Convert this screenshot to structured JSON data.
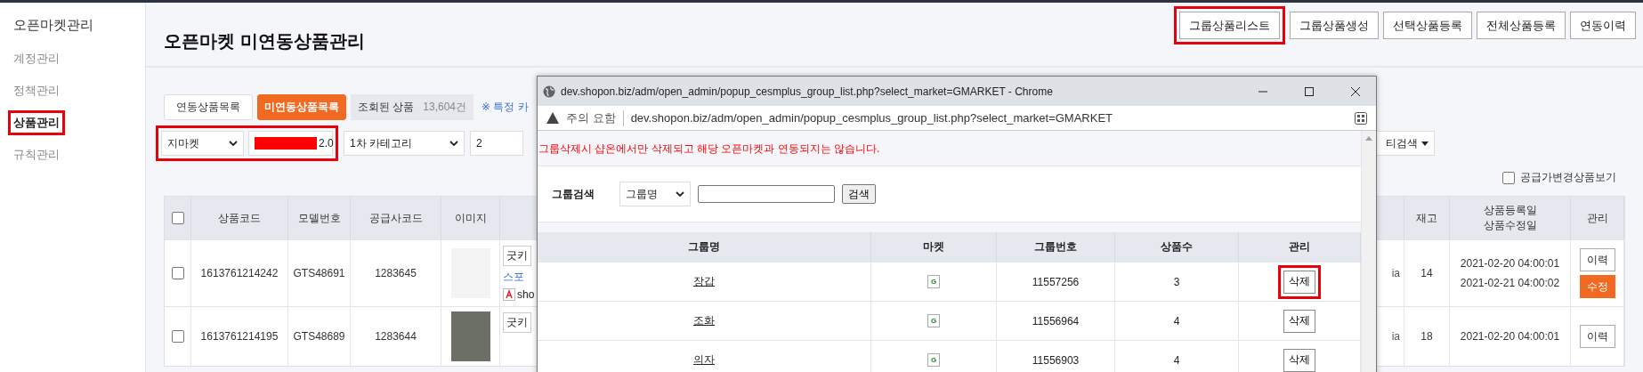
{
  "sidebar": {
    "title": "오픈마켓관리",
    "items": [
      {
        "label": "계정관리",
        "selected": false,
        "highlighted": false
      },
      {
        "label": "정책관리",
        "selected": false,
        "highlighted": false
      },
      {
        "label": "상품관리",
        "selected": true,
        "highlighted": true
      },
      {
        "label": "규칙관리",
        "selected": false,
        "highlighted": false
      }
    ]
  },
  "header": {
    "title": "오픈마켓 미연동상품관리",
    "buttons": [
      {
        "label": "그룹상품리스트",
        "highlighted": true
      },
      {
        "label": "그룹상품생성",
        "highlighted": false
      },
      {
        "label": "선택상품등록",
        "highlighted": false
      },
      {
        "label": "전체상품등록",
        "highlighted": false
      },
      {
        "label": "연동이력",
        "highlighted": false
      }
    ]
  },
  "tabs": [
    {
      "label": "연동상품목록",
      "selected": false
    },
    {
      "label": "미연동상품목록",
      "selected": true
    }
  ],
  "result": {
    "label": "조회된 상품",
    "count": "13,604건"
  },
  "notice": "※ 특정 카",
  "market_filters": {
    "highlighted": true,
    "selects": [
      {
        "value": "지마켓",
        "redacted": false
      },
      {
        "value": "2.0",
        "redacted": true
      }
    ]
  },
  "category_filters": [
    "1차 카테고리",
    "2"
  ],
  "search_toggle": "티검색",
  "supply_price_toggle": {
    "label": "공급가변경상품보기",
    "checked": false
  },
  "table": {
    "select_all": {
      "checked": false
    },
    "columns": [
      {
        "label": "상품코드"
      },
      {
        "label": "모델번호"
      },
      {
        "label": "공급사코드"
      },
      {
        "label": "이미지"
      },
      {
        "label": "재고"
      },
      {
        "label": "상품등록일",
        "sublabel": "상품수정일"
      },
      {
        "label": "관리"
      }
    ],
    "rows": [
      {
        "checked": false,
        "product_code": "1613761214242",
        "model_no": "GTS48691",
        "supplier_code": "1283645",
        "name_lines": [
          "굿키",
          "스포"
        ],
        "shop": "sho",
        "trailing": "ia",
        "stock": "14",
        "registered": "2021-02-20 04:00:01",
        "modified": "2021-02-21 04:00:02",
        "actions": [
          {
            "kind": "history",
            "label": "이력"
          },
          {
            "kind": "edit",
            "label": "수정"
          }
        ]
      },
      {
        "checked": false,
        "product_code": "1613761214195",
        "model_no": "GTS48689",
        "supplier_code": "1283644",
        "name_lines": [
          "굿키"
        ],
        "trailing": "ia",
        "stock": "18",
        "registered": "2021-02-20 04:00:01",
        "actions": [
          {
            "kind": "history",
            "label": "이력"
          }
        ]
      }
    ]
  },
  "popup": {
    "title": "dev.shopon.biz/adm/open_admin/popup_cesmplus_group_list.php?select_market=GMARKET - Chrome",
    "security": "주의 요함",
    "url": "dev.shopon.biz/adm/open_admin/popup_cesmplus_group_list.php?select_market=GMARKET",
    "notice": "그룹삭제시 샵온에서만 삭제되고 해당 오픈마켓과 연동되지는 않습니다.",
    "search": {
      "label": "그룹검색",
      "field": "그룹명",
      "button": "검색"
    },
    "columns": [
      "그룹명",
      "마켓",
      "그룹번호",
      "상품수",
      "관리"
    ],
    "rows": [
      {
        "name": "장갑",
        "market": "G",
        "group_no": "11557256",
        "count": "3",
        "action": "삭제",
        "highlighted": true
      },
      {
        "name": "조화",
        "market": "G",
        "group_no": "11556964",
        "count": "4",
        "action": "삭제",
        "highlighted": false
      },
      {
        "name": "의자",
        "market": "G",
        "group_no": "11556903",
        "count": "4",
        "action": "삭제",
        "highlighted": false
      }
    ]
  }
}
